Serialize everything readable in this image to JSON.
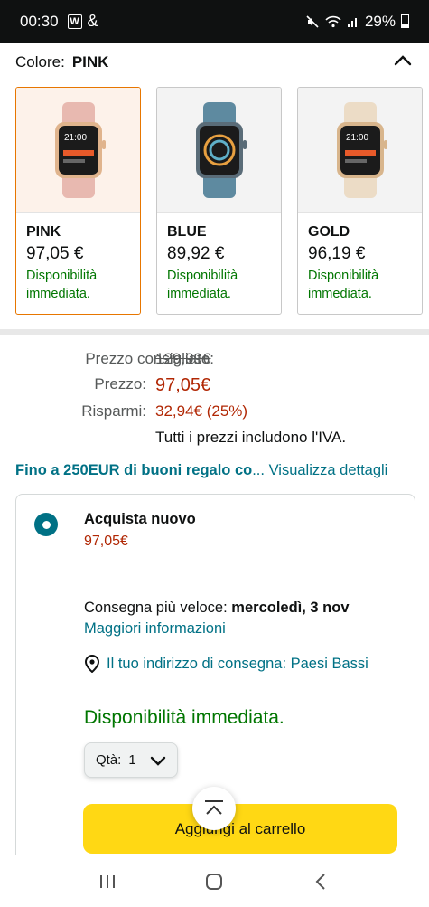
{
  "status": {
    "time": "00:30",
    "notif_w": "W",
    "notif_amp": "&",
    "battery": "29%"
  },
  "colore": {
    "label": "Colore:",
    "value": "PINK"
  },
  "swatches": [
    {
      "name": "PINK",
      "price": "97,05 €",
      "availability": "Disponibilità immediata.",
      "selected": true,
      "band_color": "#e8b9b0",
      "case_color": "#e0b48d"
    },
    {
      "name": "BLUE",
      "price": "89,92 €",
      "availability": "Disponibilità immediata.",
      "selected": false,
      "band_color": "#5e8aa0",
      "case_color": "#5a6c78"
    },
    {
      "name": "GOLD",
      "price": "96,19 €",
      "availability": "Disponibilità immediata.",
      "selected": false,
      "band_color": "#ecdcc6",
      "case_color": "#d8b58c"
    }
  ],
  "pricing": {
    "list_label": "Prezzo consigliato:",
    "list_value": "129,99€",
    "price_label": "Prezzo:",
    "price_value": "97,05€",
    "save_label": "Risparmi:",
    "save_value": "32,94€ (25%)",
    "vat_note": "Tutti i prezzi includono l'IVA."
  },
  "promo": {
    "bold": "Fino a 250EUR di buoni regalo co",
    "ellipsis": "...",
    "link": "Visualizza dettagli"
  },
  "buybox": {
    "title": "Acquista nuovo",
    "price": "97,05€",
    "delivery_prefix": "Consegna più veloce:",
    "delivery_date": "mercoledì, 3 nov",
    "more_info": "Maggiori informazioni",
    "address": "Il tuo indirizzo di consegna: Paesi Bassi",
    "availability": "Disponibilità immediata.",
    "qty_label": "Qtà:",
    "qty_value": "1",
    "add_to_cart": "Aggiungi al carrello"
  },
  "colors": {
    "accent_orange": "#e77600",
    "price_red": "#b12704",
    "link_teal": "#007185",
    "in_stock_green": "#007600",
    "cart_yellow": "#ffd814"
  }
}
